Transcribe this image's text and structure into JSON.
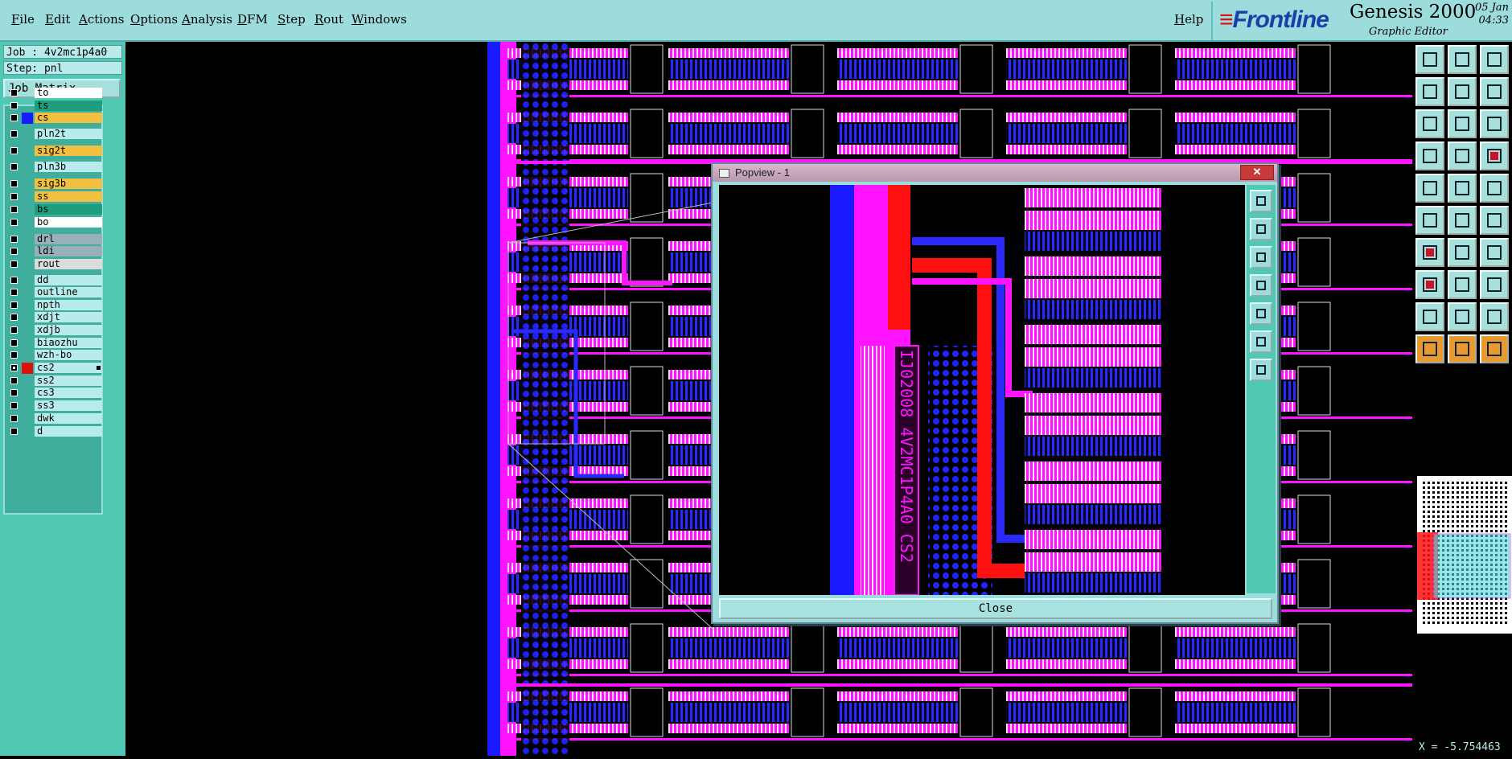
{
  "menu": {
    "items": [
      {
        "label": "File",
        "name": "menu-file"
      },
      {
        "label": "Edit",
        "name": "menu-edit"
      },
      {
        "label": "Actions",
        "name": "menu-actions"
      },
      {
        "label": "Options",
        "name": "menu-options"
      },
      {
        "label": "Analysis",
        "name": "menu-analysis"
      },
      {
        "label": "DFM",
        "name": "menu-dfm"
      },
      {
        "label": "Step",
        "name": "menu-step"
      },
      {
        "label": "Rout",
        "name": "menu-rout"
      },
      {
        "label": "Windows",
        "name": "menu-windows"
      }
    ],
    "help": "Help"
  },
  "brand": {
    "logo": "Frontline",
    "product": "Genesis 2000",
    "subtitle": "Graphic Editor",
    "date": "05 Jan",
    "time": "04:33"
  },
  "job": {
    "job_label": "Job : 4v2mc1p4a0",
    "step_label": "Step: pnl",
    "matrix_button": "Job Matrix ..."
  },
  "layers": [
    {
      "name": "to",
      "color": "#ffffff",
      "swatch": "",
      "checked": false
    },
    {
      "name": "ts",
      "color": "#1e9e7c",
      "swatch": "",
      "checked": false
    },
    {
      "name": "cs",
      "color": "#f2c040",
      "swatch": "#1a1aff",
      "checked": false
    },
    {
      "name": "pln2t",
      "color": "#b8ecec",
      "swatch": "",
      "checked": false
    },
    {
      "name": "sig2t",
      "color": "#f2c040",
      "swatch": "",
      "checked": false
    },
    {
      "name": "pln3b",
      "color": "#b8ecec",
      "swatch": "",
      "checked": false
    },
    {
      "name": "sig3b",
      "color": "#f2c040",
      "swatch": "",
      "checked": false
    },
    {
      "name": "ss",
      "color": "#f2c040",
      "swatch": "",
      "checked": false
    },
    {
      "name": "bs",
      "color": "#1e9e7c",
      "swatch": "",
      "checked": false
    },
    {
      "name": "bo",
      "color": "#ffffff",
      "swatch": "",
      "checked": false
    },
    {
      "name": "drl",
      "color": "#9ab0b8",
      "swatch": "",
      "checked": false
    },
    {
      "name": "ldi",
      "color": "#9ab0b8",
      "swatch": "",
      "checked": false
    },
    {
      "name": "rout",
      "color": "#dcdcdc",
      "swatch": "",
      "checked": false
    },
    {
      "name": "dd",
      "color": "#b8ecec",
      "swatch": "",
      "checked": false
    },
    {
      "name": "outline",
      "color": "#b8ecec",
      "swatch": "",
      "checked": false
    },
    {
      "name": "npth",
      "color": "#b8ecec",
      "swatch": "",
      "checked": false
    },
    {
      "name": "xdjt",
      "color": "#b8ecec",
      "swatch": "",
      "checked": false
    },
    {
      "name": "xdjb",
      "color": "#b8ecec",
      "swatch": "",
      "checked": false
    },
    {
      "name": "biaozhu",
      "color": "#b8ecec",
      "swatch": "",
      "checked": false
    },
    {
      "name": "wzh-bo",
      "color": "#b8ecec",
      "swatch": "",
      "checked": false
    },
    {
      "name": "cs2",
      "color": "#b8ecec",
      "swatch": "#e01010",
      "checked": true
    },
    {
      "name": "ss2",
      "color": "#b8ecec",
      "swatch": "",
      "checked": false
    },
    {
      "name": "cs3",
      "color": "#b8ecec",
      "swatch": "",
      "checked": false
    },
    {
      "name": "ss3",
      "color": "#b8ecec",
      "swatch": "",
      "checked": false
    },
    {
      "name": "dwk",
      "color": "#b8ecec",
      "swatch": "",
      "checked": false
    },
    {
      "name": "d",
      "color": "#b8ecec",
      "swatch": "",
      "checked": false
    }
  ],
  "popview": {
    "title": "Popview - 1",
    "close_label": "Close",
    "board_text": "IJ02008 4V2MC1P4A0 CS2"
  },
  "status": {
    "coord": "X = -5.754463"
  },
  "colors": {
    "magenta": "#ff14ff",
    "blue": "#1a1aff",
    "red": "#ff1010",
    "panel": "#50c8b4",
    "menubar": "#9ddcdc"
  },
  "right_tool_icons": [
    "zoom-home-icon",
    "pan-up-icon",
    "home-icon",
    "pan-left-icon",
    "pan-right-icon",
    "zoom-1-2-icon",
    "fit-icon",
    "zoom-icon",
    "ratio-icon",
    "film-icon",
    "grid-icon",
    "snap-icon",
    "pad-icon",
    "line-icon",
    "ruler-icon",
    "connect-icon",
    "delete-icon",
    "move-icon",
    "draw-red-icon",
    "line-blue-icon",
    "rotate-icon",
    "add-pad-icon",
    "slice-icon",
    "measure-icon",
    "triangle-icon",
    "triangle-a-icon",
    "triangle-b-icon",
    "select-icon",
    "select-pointer-icon",
    "select-orange-icon"
  ],
  "popview_tool_icons": [
    "pv-copy-icon",
    "pv-up-icon",
    "pv-down-icon",
    "pv-left-icon",
    "pv-right-icon",
    "pv-zoom-in-icon",
    "pv-zoom-out-icon"
  ]
}
